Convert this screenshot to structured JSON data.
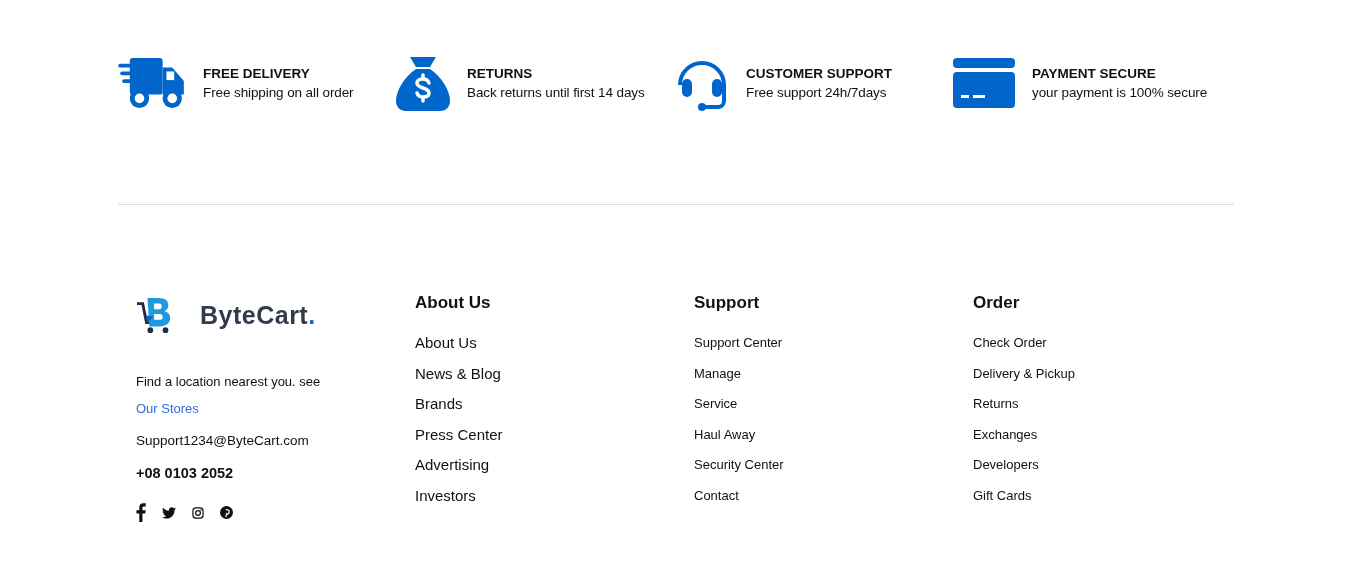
{
  "features": [
    {
      "kind": "truck",
      "title": "FREE DELIVERY",
      "text": "Free shipping on all order"
    },
    {
      "kind": "moneybag",
      "title": "RETURNS",
      "text": "Back returns until first 14 days"
    },
    {
      "kind": "headset",
      "title": "CUSTOMER SUPPORT",
      "text": "Free support 24h/7days"
    },
    {
      "kind": "card",
      "title": "PAYMENT SECURE",
      "text": "your payment is 100% secure"
    }
  ],
  "footer": {
    "brand": {
      "logo": {
        "name": "ByteCart",
        "dot": "."
      },
      "location_text": "Find a location nearest you. see",
      "location_link": "Our Stores",
      "email": "Support1234@ByteCart.com",
      "phone": "+08 0103 2052",
      "social": [
        {
          "kind": "facebook"
        },
        {
          "kind": "twitter"
        },
        {
          "kind": "instagram"
        },
        {
          "kind": "pinterest"
        }
      ]
    },
    "columns": [
      {
        "heading": "About Us",
        "links": [
          "About Us",
          "News & Blog",
          "Brands",
          "Press Center",
          "Advertising",
          "Investors"
        ]
      },
      {
        "heading": "Support",
        "links": [
          "Support Center",
          "Manage",
          "Service",
          "Haul Away",
          "Security Center",
          "Contact"
        ]
      },
      {
        "heading": "Order",
        "links": [
          "Check Order",
          "Delivery & Pickup",
          "Returns",
          "Exchanges",
          "Developers",
          "Gift Cards"
        ]
      }
    ]
  }
}
